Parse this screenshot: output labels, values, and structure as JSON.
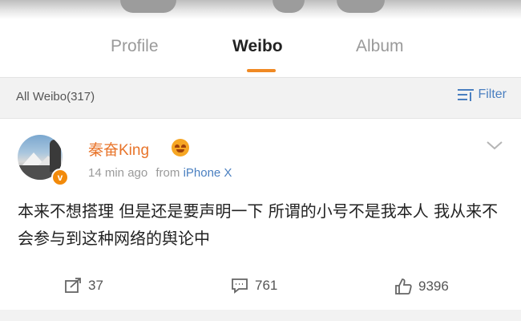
{
  "tabs": {
    "profile_label": "Profile",
    "weibo_label": "Weibo",
    "album_label": "Album",
    "active": "Weibo"
  },
  "filter_bar": {
    "count_label": "All Weibo(317)",
    "filter_label": "Filter",
    "filter_icon": "filter-icon"
  },
  "post": {
    "username": "秦奋King",
    "time": "14 min ago",
    "from_prefix": "from",
    "source": "iPhone X",
    "verified_mark": "v",
    "content": "本来不想搭理 但是还是要声明一下 所谓的小号不是我本人 我从来不会参与到这种网络的舆论中",
    "actions": {
      "repost_count": "37",
      "comment_count": "761",
      "like_count": "9396"
    }
  },
  "colors": {
    "accent": "#f08a24",
    "username": "#e8742a",
    "link": "#4a7fc0",
    "muted": "#9a9a9a"
  }
}
